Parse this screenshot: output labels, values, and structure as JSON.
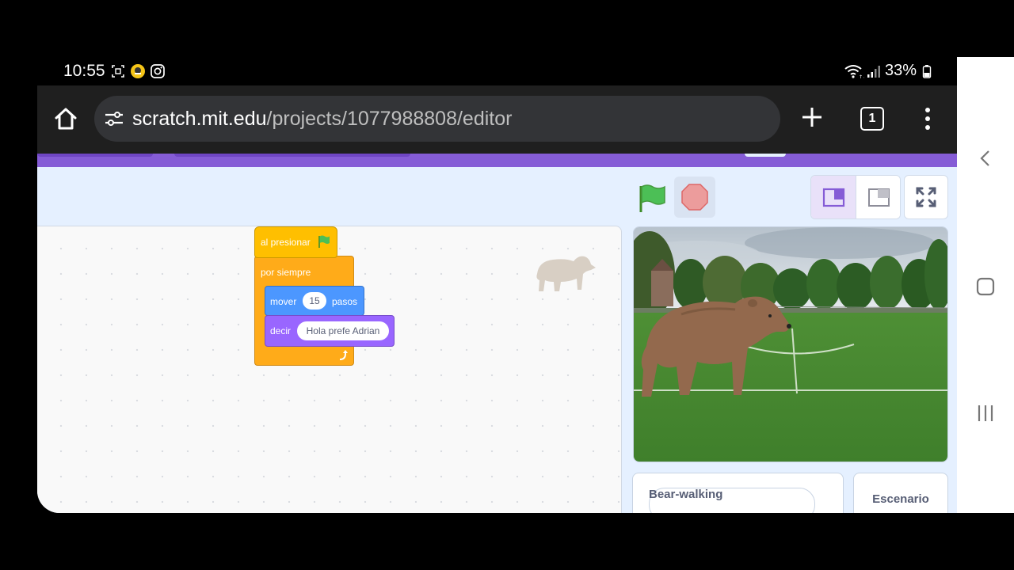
{
  "status_bar": {
    "time": "10:55",
    "battery": "33%"
  },
  "browser": {
    "url_host": "scratch.mit.edu",
    "url_path": "/projects/1077988808/editor",
    "tab_count": "1"
  },
  "blocks": {
    "hat_label": "al presionar",
    "forever_label": "por siempre",
    "move_label": "mover",
    "move_steps": "15",
    "move_unit": "pasos",
    "say_label": "decir",
    "say_text": "Hola prefe Adrian"
  },
  "sprite_pane": {
    "sprite_name": "Bear-walking"
  },
  "backdrop_pane": {
    "label": "Escenario"
  },
  "colors": {
    "scratch_purple": "#855cd6",
    "events_yellow": "#ffbf00",
    "control_orange": "#ffab19",
    "motion_blue": "#4c97ff",
    "looks_purple": "#9966ff"
  }
}
